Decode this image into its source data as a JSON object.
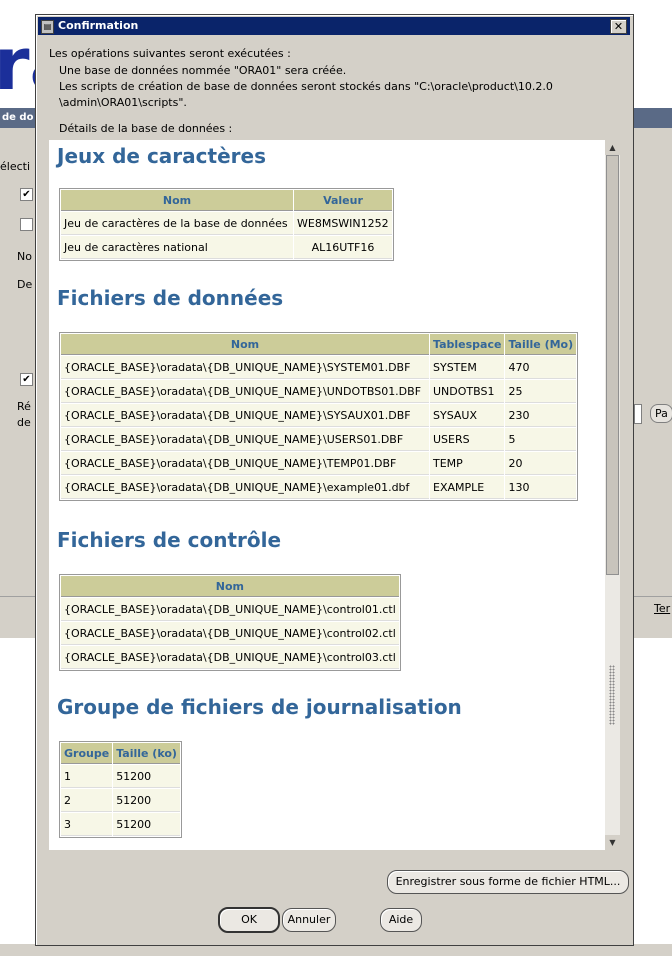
{
  "background": {
    "logo_text": "ra",
    "titlebar_text": "de do",
    "selection_label": "électi",
    "nom_label": "No",
    "de_label": "De",
    "re_label": "Ré",
    "de2_label": "de",
    "pa_button": "Pa",
    "ter_label": "Ter"
  },
  "dialog": {
    "title": "Confirmation",
    "close_glyph": "✕",
    "intro": [
      "Les opérations suivantes seront exécutées :",
      "Une base de données nommée \"ORA01\" sera créée.",
      "Les scripts de création de base de données seront stockés dans \"C:\\oracle\\product\\10.2.0",
      "\\admin\\ORA01\\scripts\".",
      "Détails de la base de données :"
    ],
    "sections": {
      "charsets": {
        "heading": "Jeux de caractères",
        "headers": [
          "Nom",
          "Valeur"
        ],
        "rows": [
          [
            "Jeu de caractères de la base de données",
            "WE8MSWIN1252"
          ],
          [
            "Jeu de caractères national",
            "AL16UTF16"
          ]
        ]
      },
      "datafiles": {
        "heading": "Fichiers de données",
        "headers": [
          "Nom",
          "Tablespace",
          "Taille (Mo)"
        ],
        "rows": [
          [
            "{ORACLE_BASE}\\oradata\\{DB_UNIQUE_NAME}\\SYSTEM01.DBF",
            "SYSTEM",
            "470"
          ],
          [
            "{ORACLE_BASE}\\oradata\\{DB_UNIQUE_NAME}\\UNDOTBS01.DBF",
            "UNDOTBS1",
            "25"
          ],
          [
            "{ORACLE_BASE}\\oradata\\{DB_UNIQUE_NAME}\\SYSAUX01.DBF",
            "SYSAUX",
            "230"
          ],
          [
            "{ORACLE_BASE}\\oradata\\{DB_UNIQUE_NAME}\\USERS01.DBF",
            "USERS",
            "5"
          ],
          [
            "{ORACLE_BASE}\\oradata\\{DB_UNIQUE_NAME}\\TEMP01.DBF",
            "TEMP",
            "20"
          ],
          [
            "{ORACLE_BASE}\\oradata\\{DB_UNIQUE_NAME}\\example01.dbf",
            "EXAMPLE",
            "130"
          ]
        ]
      },
      "controlfiles": {
        "heading": "Fichiers de contrôle",
        "headers": [
          "Nom"
        ],
        "rows": [
          [
            "{ORACLE_BASE}\\oradata\\{DB_UNIQUE_NAME}\\control01.ctl"
          ],
          [
            "{ORACLE_BASE}\\oradata\\{DB_UNIQUE_NAME}\\control02.ctl"
          ],
          [
            "{ORACLE_BASE}\\oradata\\{DB_UNIQUE_NAME}\\control03.ctl"
          ]
        ]
      },
      "redologs": {
        "heading": "Groupe de fichiers de journalisation",
        "headers": [
          "Groupe",
          "Taille (ko)"
        ],
        "rows": [
          [
            "1",
            "51200"
          ],
          [
            "2",
            "51200"
          ],
          [
            "3",
            "51200"
          ]
        ]
      }
    },
    "buttons": {
      "save_html": "Enregistrer sous forme de fichier HTML...",
      "ok": "OK",
      "cancel": "Annuler",
      "help": "Aide"
    }
  }
}
